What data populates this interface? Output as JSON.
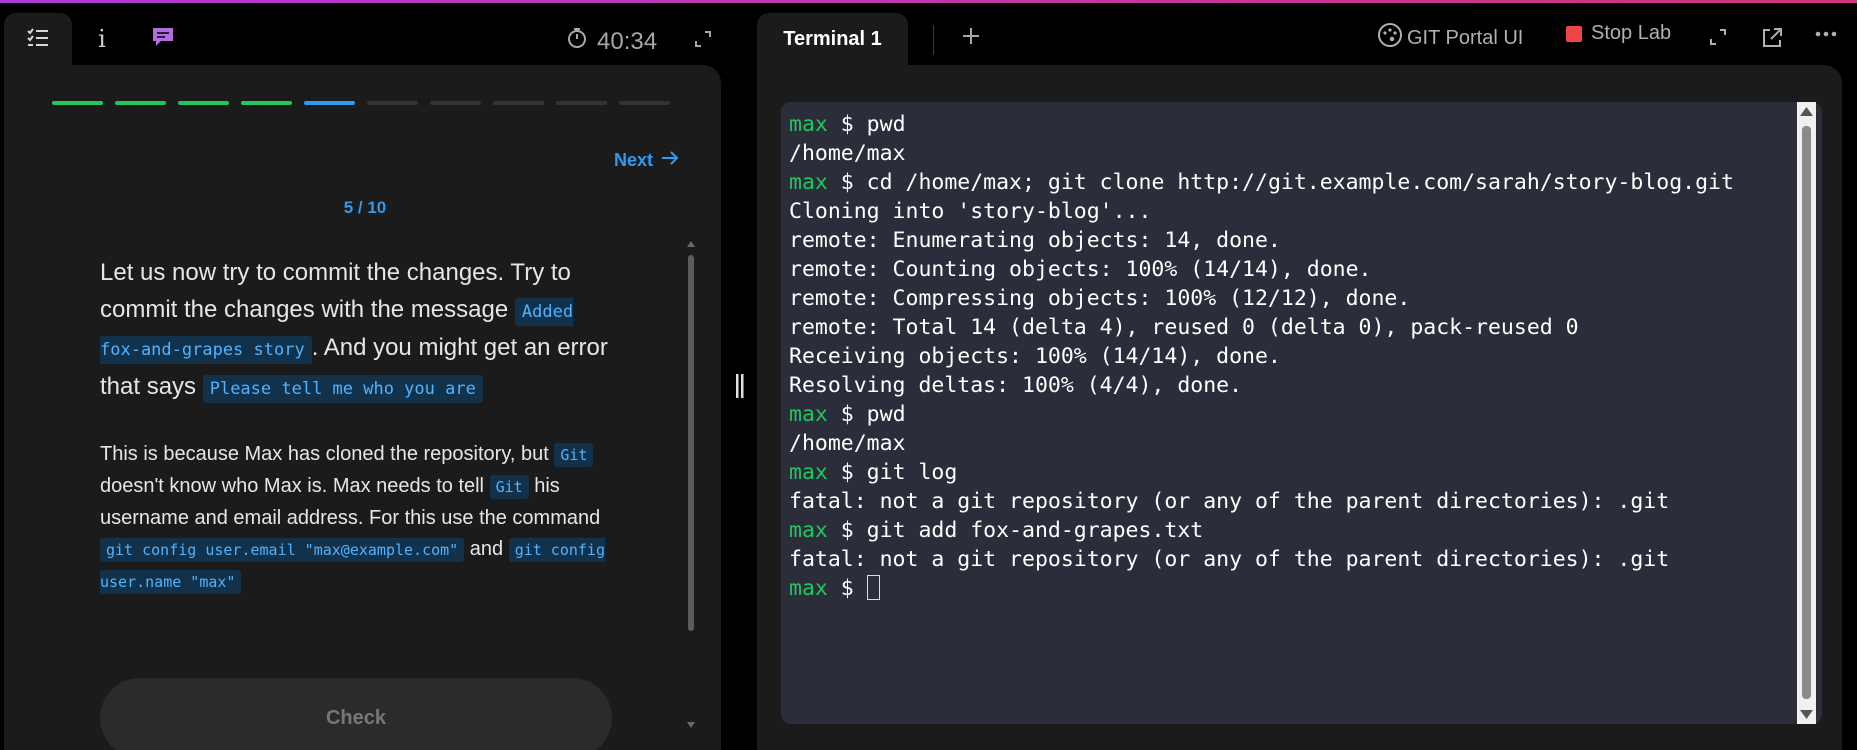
{
  "left_tabs": {
    "items": [
      {
        "name": "checklist",
        "icon": "checklist-icon"
      },
      {
        "name": "info",
        "label": "i",
        "icon": "info-icon"
      },
      {
        "name": "chat",
        "icon": "chat-bubble-icon"
      }
    ],
    "timer": "40:34"
  },
  "lesson": {
    "progress": {
      "total": 10,
      "completed": 4,
      "current": 5
    },
    "next_label": "Next",
    "counter": "5 / 10",
    "p1": {
      "t1": "Let us now try to commit the changes. Try to commit the changes with the message ",
      "c1": "Added fox-and-grapes story",
      "t2": ". And you might get an error that says ",
      "c2": "Please tell me who you are"
    },
    "p2": {
      "t1": "This is because Max has cloned the repository, but ",
      "c1": "Git",
      "t2": " doesn't know who Max is. Max needs to tell ",
      "c2": "Git",
      "t3": " his username and email address. For this use the command ",
      "c3": "git config user.email \"max@example.com\"",
      "t4": " and ",
      "c4": "git config user.name \"max\""
    },
    "check_label": "Check"
  },
  "divider": {
    "handle": "||"
  },
  "terminal_tabs": {
    "active": "Terminal 1",
    "add": "+"
  },
  "toolbar": {
    "git_portal": "GIT Portal UI",
    "stop_lab": "Stop Lab",
    "stop_color": "#ef4444"
  },
  "terminal": {
    "prompt": "max",
    "lines": [
      {
        "type": "cmd",
        "text": " $ pwd"
      },
      {
        "type": "out",
        "text": "/home/max"
      },
      {
        "type": "cmd",
        "text": " $ cd /home/max; git clone http://git.example.com/sarah/story-blog.git"
      },
      {
        "type": "out",
        "text": "Cloning into 'story-blog'..."
      },
      {
        "type": "out",
        "text": "remote: Enumerating objects: 14, done."
      },
      {
        "type": "out",
        "text": "remote: Counting objects: 100% (14/14), done."
      },
      {
        "type": "out",
        "text": "remote: Compressing objects: 100% (12/12), done."
      },
      {
        "type": "out",
        "text": "remote: Total 14 (delta 4), reused 0 (delta 0), pack-reused 0"
      },
      {
        "type": "out",
        "text": "Receiving objects: 100% (14/14), done."
      },
      {
        "type": "out",
        "text": "Resolving deltas: 100% (4/4), done."
      },
      {
        "type": "cmd",
        "text": " $ pwd"
      },
      {
        "type": "out",
        "text": "/home/max"
      },
      {
        "type": "cmd",
        "text": " $ git log"
      },
      {
        "type": "out",
        "text": "fatal: not a git repository (or any of the parent directories): .git"
      },
      {
        "type": "cmd",
        "text": " $ git add fox-and-grapes.txt"
      },
      {
        "type": "out",
        "text": "fatal: not a git repository (or any of the parent directories): .git"
      },
      {
        "type": "cmd",
        "text": " $ ",
        "cursor": true
      }
    ]
  }
}
